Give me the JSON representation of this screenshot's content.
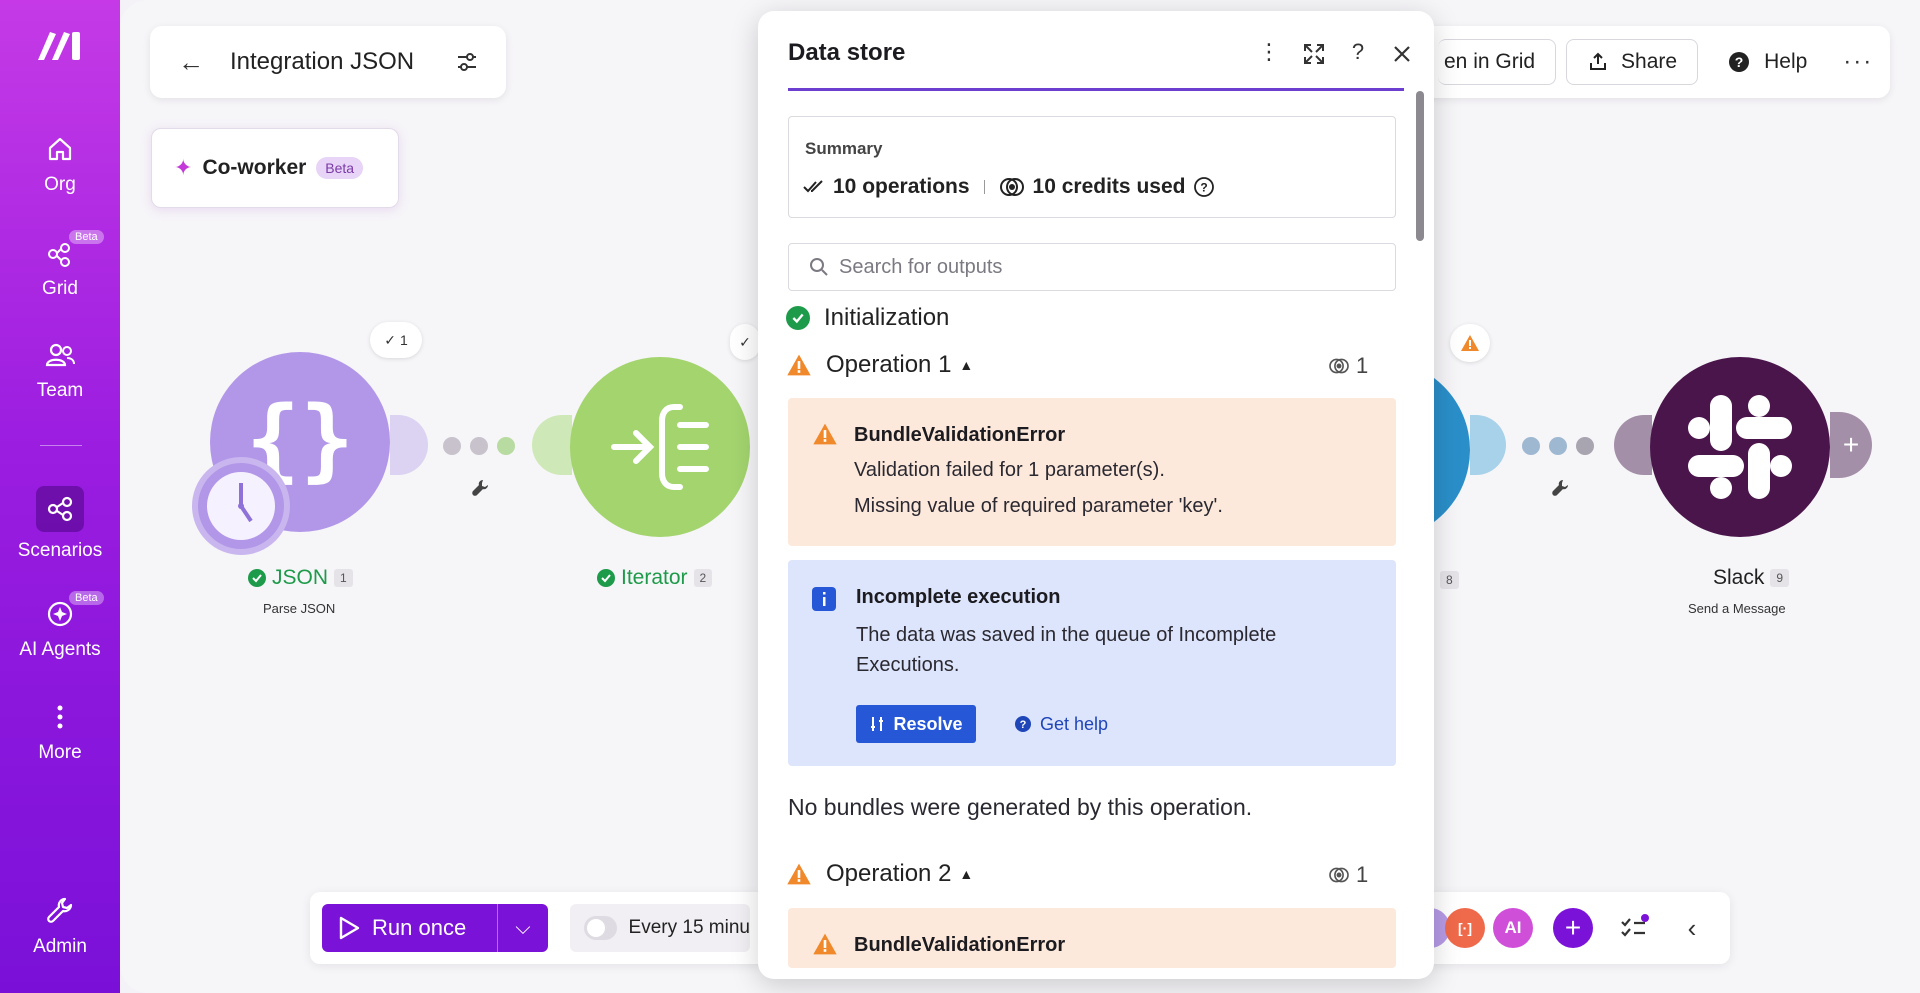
{
  "sidebar": {
    "items": [
      {
        "label": "Org",
        "icon": "home-icon"
      },
      {
        "label": "Grid",
        "icon": "grid-icon",
        "badge": "Beta"
      },
      {
        "label": "Team",
        "icon": "team-icon"
      },
      {
        "label": "Scenarios",
        "icon": "scenarios-icon",
        "active": true
      },
      {
        "label": "AI Agents",
        "icon": "ai-agents-icon",
        "badge": "Beta"
      },
      {
        "label": "More",
        "icon": "more-vertical-icon"
      },
      {
        "label": "Admin",
        "icon": "wrench-icon"
      }
    ]
  },
  "header": {
    "title": "Integration JSON",
    "coworker_label": "Co-worker",
    "coworker_badge": "Beta",
    "open_in_grid": "en in Grid",
    "share": "Share",
    "help": "Help"
  },
  "modules": [
    {
      "name": "JSON",
      "num": "1",
      "sub": "Parse JSON",
      "ops": "1",
      "color": "#b297e8"
    },
    {
      "name": "Iterator",
      "num": "2",
      "color": "#a3d46e"
    },
    {
      "num": "8",
      "color": "#2a8fc9"
    },
    {
      "name": "Slack",
      "num": "9",
      "sub": "Send a Message",
      "color": "#4a154b"
    }
  ],
  "bottom_bar": {
    "run_label": "Run once",
    "schedule": "Every 15 minu",
    "ai_label": "AI"
  },
  "panel": {
    "title": "Data store",
    "summary": {
      "heading": "Summary",
      "operations": "10 operations",
      "credits": "10 credits used"
    },
    "search_placeholder": "Search for outputs",
    "initialization": "Initialization",
    "operation1": {
      "label": "Operation 1",
      "count": "1",
      "error_title": "BundleValidationError",
      "error_line1": "Validation failed for 1 parameter(s).",
      "error_line2": "Missing value of required parameter 'key'."
    },
    "incomplete": {
      "title": "Incomplete execution",
      "message": "The data was saved in the queue of Incomplete Executions.",
      "resolve": "Resolve",
      "get_help": "Get help"
    },
    "no_bundles": "No bundles were generated by this operation.",
    "operation2": {
      "label": "Operation 2",
      "count": "1",
      "error_title": "BundleValidationError"
    }
  },
  "colors": {
    "accent": "#7b12d8",
    "warning": "#f0892b",
    "success": "#1e9b4a",
    "info": "#2557d6"
  }
}
